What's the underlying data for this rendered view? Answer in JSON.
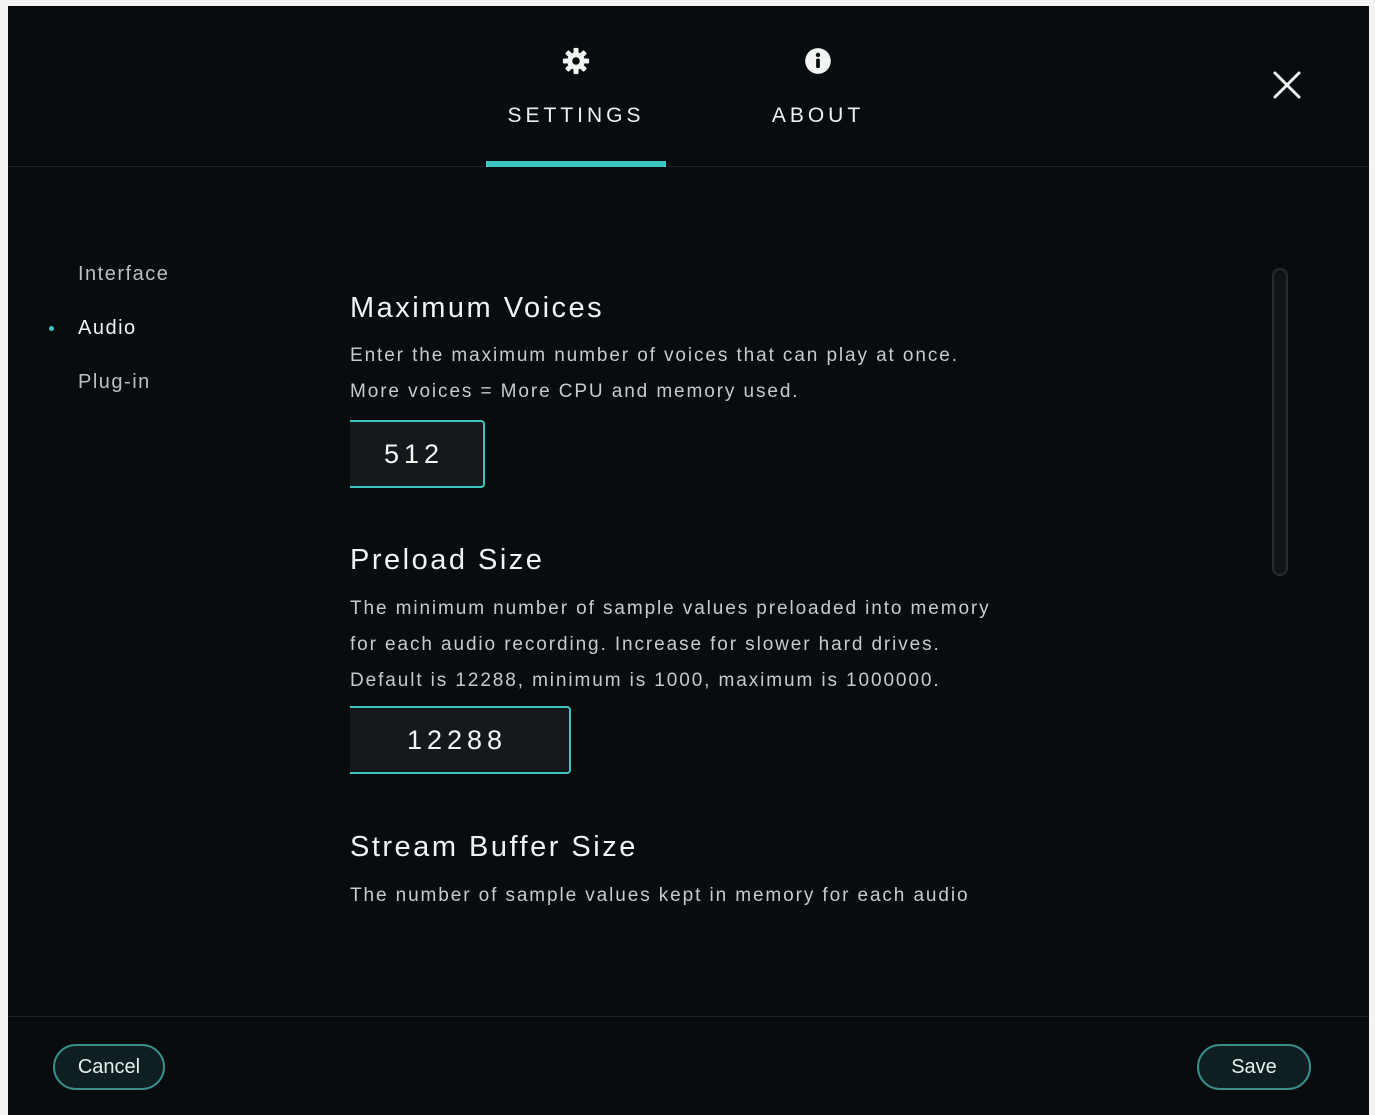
{
  "tabs": [
    {
      "label": "SETTINGS",
      "icon": "gear-icon",
      "active": true
    },
    {
      "label": "ABOUT",
      "icon": "info-icon",
      "active": false
    }
  ],
  "sidebar": {
    "items": [
      {
        "label": "Interface",
        "active": false
      },
      {
        "label": "Audio",
        "active": true
      },
      {
        "label": "Plug-in",
        "active": false
      }
    ]
  },
  "sections": {
    "max_voices": {
      "title": "Maximum Voices",
      "desc_lines": [
        "Enter the maximum number of voices that can play at once.",
        "More voices = More CPU and memory used."
      ],
      "value": "512"
    },
    "preload_size": {
      "title": "Preload Size",
      "desc_lines": [
        "The minimum number of sample values preloaded into memory",
        "for each audio recording. Increase for slower hard drives.",
        "Default is 12288, minimum is 1000, maximum is 1000000."
      ],
      "value": "12288"
    },
    "stream_buffer": {
      "title": "Stream Buffer Size",
      "desc_lines": [
        "The number of sample values kept in memory for each audio"
      ]
    }
  },
  "footer": {
    "cancel_label": "Cancel",
    "save_label": "Save"
  },
  "colors": {
    "accent": "#3ec6c3",
    "background": "#080c0e",
    "text": "#e6e8e8"
  },
  "icons": {
    "close": "close-icon",
    "active_indicator": "dot-indicator"
  }
}
